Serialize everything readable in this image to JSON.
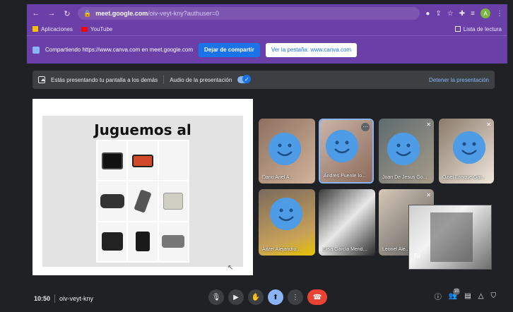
{
  "browser": {
    "url_host": "meet.google.com",
    "url_path": "/oiv-veyt-kny?authuser=0",
    "profile_initial": "A",
    "bookmarks": [
      {
        "label": "Aplicaciones"
      },
      {
        "label": "YouTube"
      }
    ],
    "reading_list": "Lista de lectura"
  },
  "share_bar": {
    "text": "Compartiendo https://www.canva.com en meet.google.com",
    "stop_label": "Dejar de compartir",
    "show_tab_label": "Ver la pestaña: www.canva.com"
  },
  "present_banner": {
    "text": "Estás presentando tu pantalla a los demás",
    "audio_label": "Audio de la presentación",
    "stop_label": "Detener la presentación"
  },
  "slide": {
    "title": "Juguemos al memorama"
  },
  "participants": [
    {
      "name": "Dario Ariel A..."
    },
    {
      "name": "Andres Puente Io..."
    },
    {
      "name": "Joan De Jesus Go..."
    },
    {
      "name": "Oziel Enrique Gar..."
    },
    {
      "name": "Aitzel Alejandro..."
    },
    {
      "name": "Elisa García Mend..."
    },
    {
      "name": "Leonel Ale..."
    }
  ],
  "self_view": {
    "label": "Tú"
  },
  "meeting": {
    "time": "10:50",
    "code": "oiv-veyt-kny",
    "participants_count": "10"
  },
  "colors": {
    "chrome_purple": "#6b3fa8",
    "meet_dark": "#202124",
    "accent_blue": "#8ab4f8",
    "hangup_red": "#ea4335"
  }
}
